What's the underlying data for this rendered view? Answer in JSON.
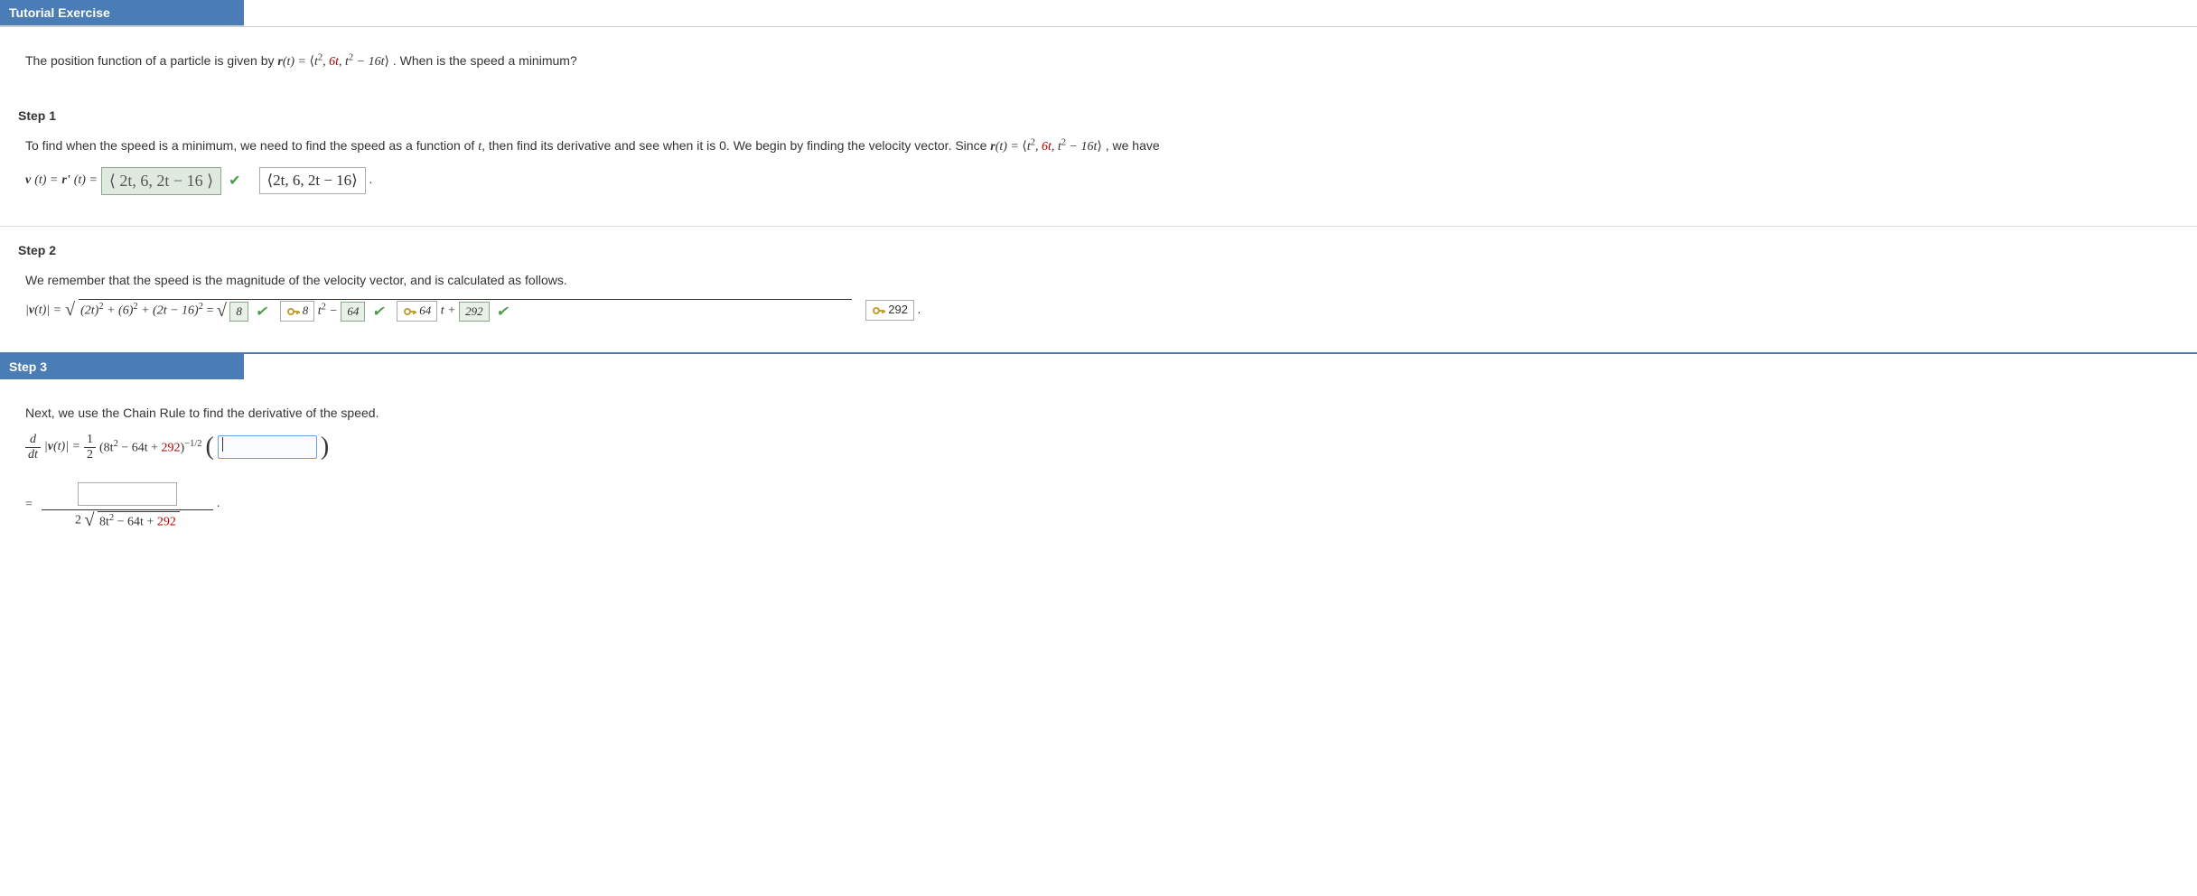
{
  "header": {
    "title": "Tutorial Exercise"
  },
  "exercise": {
    "intro_a": "The position function of a particle is given by ",
    "r_label": "r",
    "r_of_t": "(t) = ",
    "vec_open": "⟨",
    "comp1_a": "t",
    "comp1_b": "2",
    "comp2": "6t",
    "comp3_a": "t",
    "comp3_b": "2",
    "comp3_c": " − 16t",
    "vec_close": "⟩",
    "intro_b": ". When is the speed a minimum?"
  },
  "step1": {
    "title": "Step 1",
    "text_a": "To find when the speed is a minimum, we need to find the speed as a function of ",
    "t": "t",
    "text_b": ", then find its derivative and see when it is 0. We begin by finding the velocity vector. Since ",
    "r_eq": "r",
    "r_eq2": "(t) = ",
    "tail": ", we have",
    "lhs_v": "v",
    "lhs_t": "(t) = ",
    "rprime": "r'",
    "rprime_t": "(t) = ",
    "answer": "⟨ 2t, 6, 2t − 16 ⟩",
    "confirm": "⟨2t, 6, 2t − 16⟩",
    "period": " ."
  },
  "step2": {
    "title": "Step 2",
    "text": "We remember that the speed is the magnitude of the velocity vector, and is calculated as follows.",
    "lhs": "|v(t)| = ",
    "under": "(2t)² + (6)² + (2t − 16)²",
    "eq": " = ",
    "b1": "8",
    "key2": "8",
    "tsq": " t² − ",
    "b2": "64",
    "key3": "64",
    "tterm": " t + ",
    "b3": "292",
    "key4": "292",
    "period": " ."
  },
  "step3": {
    "title": "Step 3",
    "text": "Next, we use the Chain Rule to find the derivative of the speed.",
    "d": "d",
    "dt": "dt",
    "mag": "|v(t)| = ",
    "half_n": "1",
    "half_d": "2",
    "poly_a": "(8t",
    "poly_b": "2",
    "poly_c": " − 64t + ",
    "poly_d": "292",
    "poly_e": ")",
    "exp": "−1/2",
    "lparen": "(",
    "rparen": ")",
    "eq2": "=",
    "period2": ".",
    "denom_2": "2",
    "denom_poly_a": "8t",
    "denom_poly_b": "2",
    "denom_poly_c": " − 64t + ",
    "denom_poly_d": "292"
  }
}
